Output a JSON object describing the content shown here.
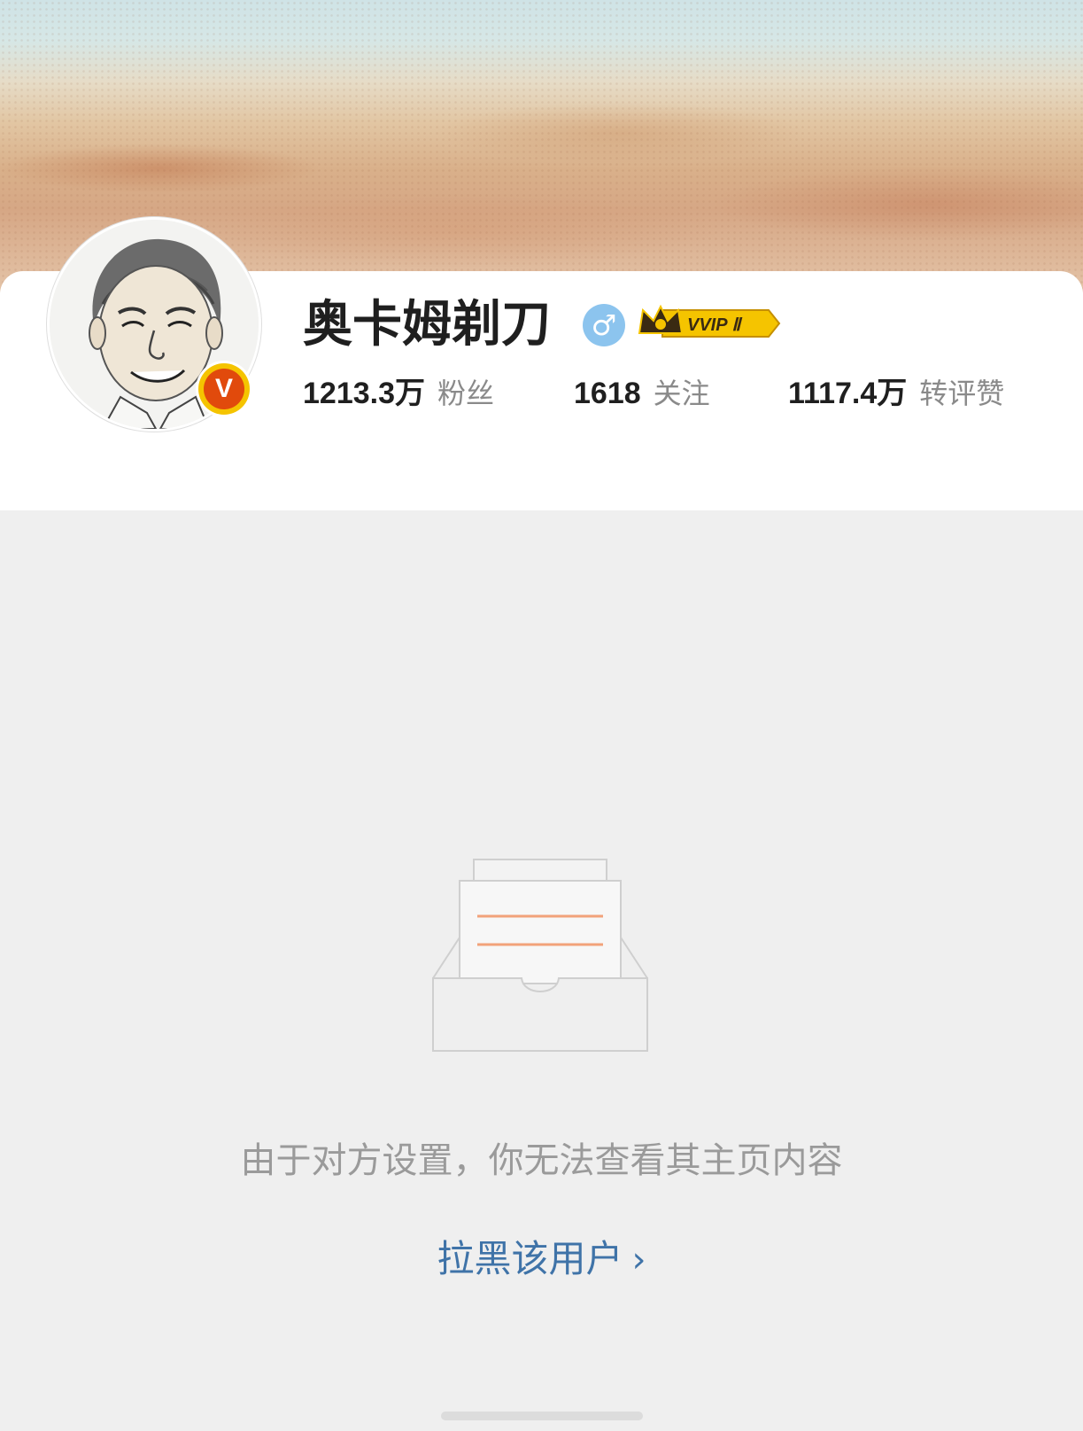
{
  "profile": {
    "name": "奥卡姆剃刀",
    "gender_symbol": "♂",
    "gender_icon": "male-icon",
    "vip_badge_text": "VVIP Ⅱ",
    "verified_badge_text": "V"
  },
  "stats": [
    {
      "value": "1213.3万",
      "label": "粉丝"
    },
    {
      "value": "1618",
      "label": "关注"
    },
    {
      "value": "1117.4万",
      "label": "转评赞"
    }
  ],
  "empty_state": {
    "message": "由于对方设置，你无法查看其主页内容",
    "action_label": "拉黑该用户",
    "action_chevron": "›",
    "illustration_icon": "empty-inbox-icon"
  },
  "colors": {
    "link": "#3f73a8",
    "verified_badge": "#e14a0c",
    "gender_badge": "#8cc4ee",
    "vip_gold": "#f5c400"
  }
}
